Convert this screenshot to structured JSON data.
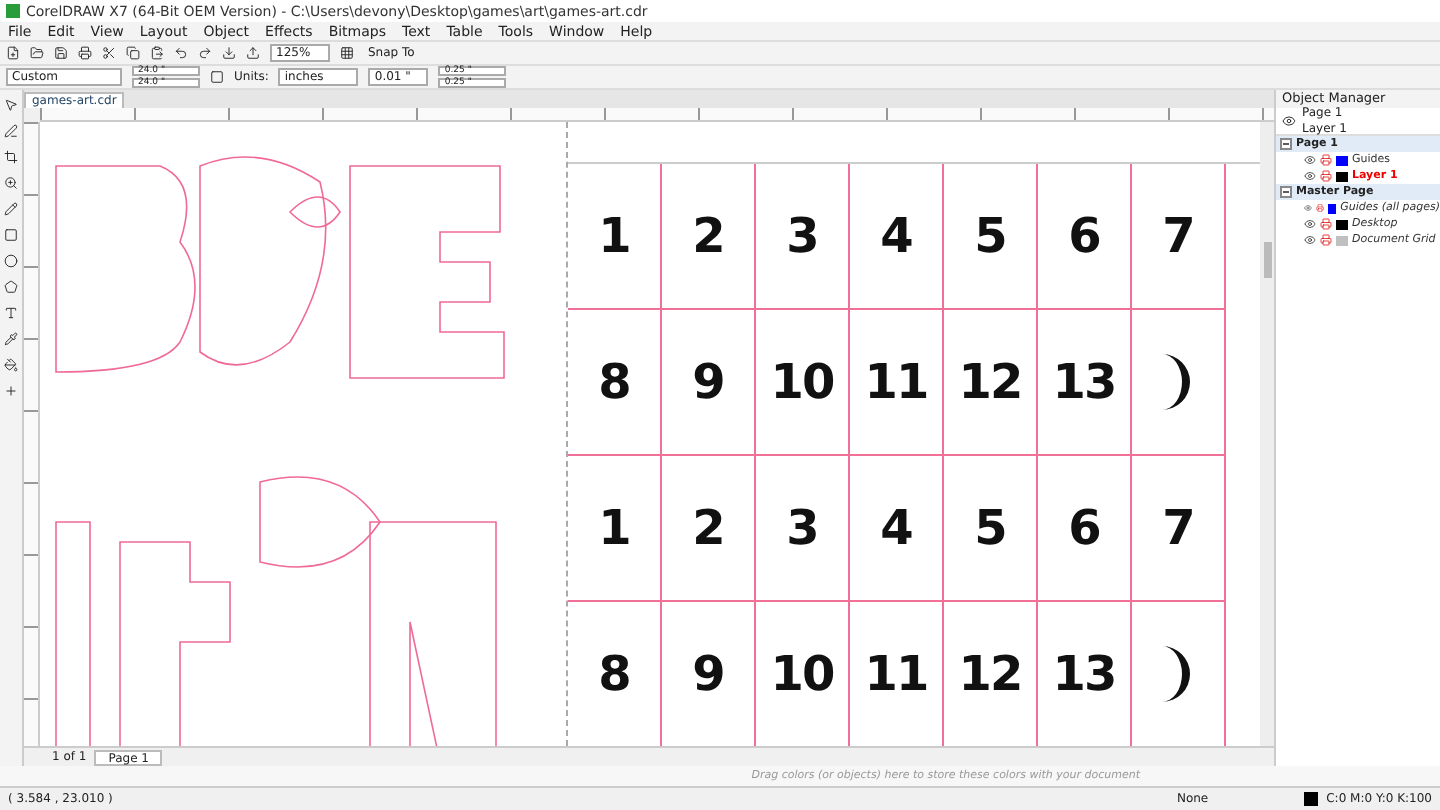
{
  "window": {
    "title": "CorelDRAW X7 (64-Bit OEM Version) - C:\\Users\\devony\\Desktop\\games\\art\\games-art.cdr"
  },
  "menu": [
    "File",
    "Edit",
    "View",
    "Layout",
    "Object",
    "Effects",
    "Bitmaps",
    "Text",
    "Table",
    "Tools",
    "Window",
    "Help"
  ],
  "toolbar": {
    "zoom": "125%",
    "snap": "Snap To"
  },
  "property_bar": {
    "preset": "Custom",
    "width": "24.0 \"",
    "height": "24.0 \"",
    "units_label": "Units:",
    "units": "inches",
    "nudge": "0.01 \"",
    "dup_x": "0.25 \"",
    "dup_y": "0.25 \""
  },
  "document_tab": "games-art.cdr",
  "cards": [
    {
      "kind": "number",
      "text": "1"
    },
    {
      "kind": "number",
      "text": "2"
    },
    {
      "kind": "number",
      "text": "3"
    },
    {
      "kind": "number",
      "text": "4"
    },
    {
      "kind": "number",
      "text": "5"
    },
    {
      "kind": "number",
      "text": "6"
    },
    {
      "kind": "number",
      "text": "7"
    },
    {
      "kind": "number",
      "text": "8"
    },
    {
      "kind": "number",
      "text": "9"
    },
    {
      "kind": "number",
      "text": "10"
    },
    {
      "kind": "number",
      "text": "11"
    },
    {
      "kind": "number",
      "text": "12"
    },
    {
      "kind": "number",
      "text": "13"
    },
    {
      "kind": "moon"
    },
    {
      "kind": "number",
      "text": "1"
    },
    {
      "kind": "number",
      "text": "2"
    },
    {
      "kind": "number",
      "text": "3"
    },
    {
      "kind": "number",
      "text": "4"
    },
    {
      "kind": "number",
      "text": "5"
    },
    {
      "kind": "number",
      "text": "6"
    },
    {
      "kind": "number",
      "text": "7"
    },
    {
      "kind": "number",
      "text": "8"
    },
    {
      "kind": "number",
      "text": "9"
    },
    {
      "kind": "number",
      "text": "10"
    },
    {
      "kind": "number",
      "text": "11"
    },
    {
      "kind": "number",
      "text": "12"
    },
    {
      "kind": "number",
      "text": "13"
    },
    {
      "kind": "moon"
    }
  ],
  "page_nav": {
    "count": "1 of 1",
    "tab": "Page 1"
  },
  "palette_hint": "Drag colors (or objects) here to store these colors with your document",
  "object_manager": {
    "title": "Object Manager",
    "page": "Page 1",
    "layer": "Layer 1",
    "tree": [
      {
        "label": "Page 1",
        "expanded": true,
        "children": [
          {
            "label": "Guides",
            "color": "#0000ff",
            "active": false
          },
          {
            "label": "Layer 1",
            "color": "#000000",
            "active": true
          }
        ]
      },
      {
        "label": "Master Page",
        "expanded": true,
        "children": [
          {
            "label": "Guides (all pages)",
            "color": "#0000ff",
            "active": false
          },
          {
            "label": "Desktop",
            "color": "#000000",
            "active": false
          },
          {
            "label": "Document Grid",
            "color": "#c0c0c0",
            "active": false
          }
        ]
      }
    ]
  },
  "status": {
    "coords": "( 3.584 , 23.010 )",
    "fill": "None",
    "outline": "C:0 M:0 Y:0 K:100"
  }
}
